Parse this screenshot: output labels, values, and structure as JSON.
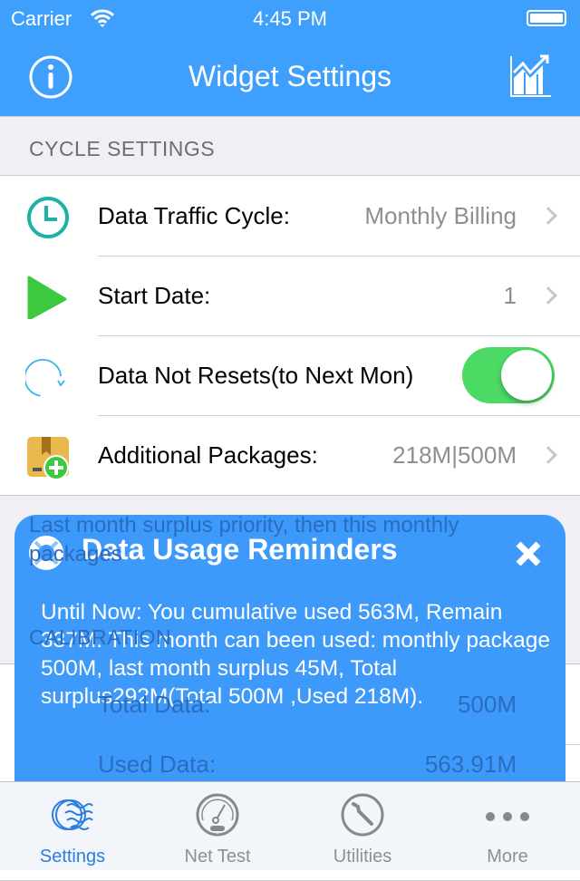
{
  "status_bar": {
    "carrier": "Carrier",
    "time": "4:45 PM"
  },
  "nav": {
    "title": "Widget Settings",
    "left_icon": "info-icon",
    "right_icon": "chart-icon"
  },
  "cycle_settings": {
    "header": "CYCLE SETTINGS",
    "rows": [
      {
        "label": "Data Traffic Cycle:",
        "value": "Monthly Billing",
        "icon": "clock-icon"
      },
      {
        "label": "Start Date:",
        "value": "1",
        "icon": "play-icon"
      },
      {
        "label": "Data Not Resets(to Next Mon)",
        "toggle": true,
        "icon": "refresh-icon"
      },
      {
        "label": "Additional Packages:",
        "value": "218M|500M",
        "icon": "package-add-icon"
      }
    ],
    "footer": "Last month surplus priority, then this monthly packages"
  },
  "calibration": {
    "header": "CALIBRATION",
    "rows": [
      {
        "label": "Total Data:",
        "value": "500M"
      },
      {
        "label": "Used Data:",
        "value": "563.91M"
      }
    ]
  },
  "popup": {
    "title": "Data Usage Reminders",
    "body": "Until Now: You cumulative used 563M, Remain 337M. This month can been used: monthly package 500M, last month surplus 45M, Total surplus292M(Total 500M ,Used 218M)."
  },
  "tabs": [
    {
      "label": "Settings",
      "active": true
    },
    {
      "label": "Net Test"
    },
    {
      "label": "Utilities"
    },
    {
      "label": "More"
    }
  ],
  "colors": {
    "accent": "#3f9ffd",
    "toggle_on": "#4cd964",
    "popup": "#3696fa"
  }
}
